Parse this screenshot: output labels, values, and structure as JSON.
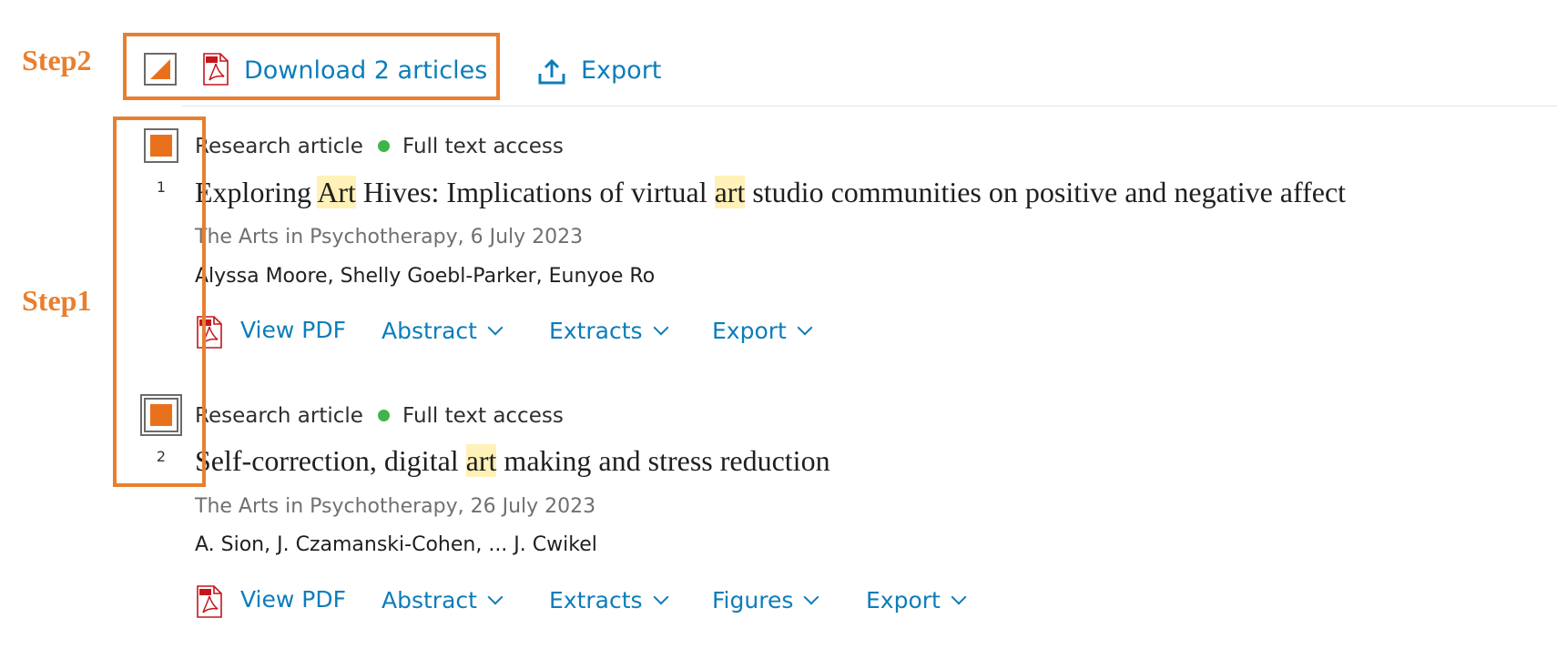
{
  "annotations": {
    "step1": "Step1",
    "step2": "Step2"
  },
  "toolbar": {
    "download_label": "Download 2 articles",
    "export_label": "Export"
  },
  "articles": [
    {
      "number": "1",
      "type": "Research article",
      "access": "Full text access",
      "title_parts": [
        "Exploring ",
        "Art",
        " Hives: Implications of virtual ",
        "art",
        " studio communities on positive and negative affect"
      ],
      "source": "The Arts in Psychotherapy, 6 July 2023",
      "authors": "Alyssa Moore, Shelly Goebl-Parker, Eunyoe Ro",
      "actions": [
        "View PDF",
        "Abstract",
        "Extracts",
        "Export"
      ]
    },
    {
      "number": "2",
      "type": "Research article",
      "access": "Full text access",
      "title_parts": [
        "Self-correction, digital ",
        "art",
        " making and stress reduction"
      ],
      "source": "The Arts in Psychotherapy, 26 July 2023",
      "authors": "A. Sion, J. Czamanski-Cohen, ... J. Cwikel",
      "actions": [
        "View PDF",
        "Abstract",
        "Extracts",
        "Figures",
        "Export"
      ]
    }
  ],
  "colors": {
    "accent": "#e87f2f",
    "link": "#0c7dbb",
    "access_dot": "#3fb548",
    "highlight": "#fff1b8"
  }
}
